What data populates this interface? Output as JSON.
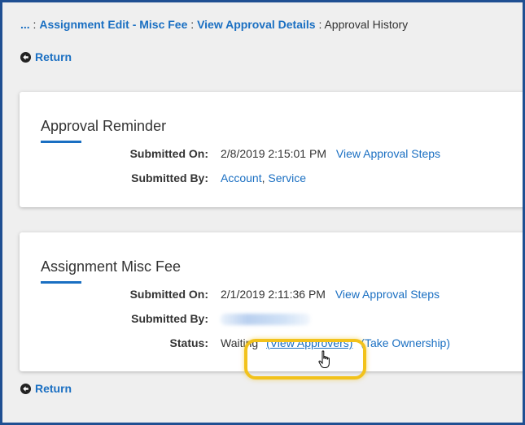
{
  "breadcrumb": {
    "ellipsis": "...",
    "sep1": " : ",
    "item1": "Assignment Edit - Misc Fee",
    "sep2": " : ",
    "item2": "View Approval Details",
    "sep3": " : ",
    "current": "Approval History"
  },
  "return_top": "Return",
  "return_bottom": "Return",
  "cards": [
    {
      "title": "Approval Reminder",
      "submitted_on_label": "Submitted On:",
      "submitted_on_value": "2/8/2019 2:15:01 PM",
      "view_steps": "View Approval Steps",
      "submitted_by_label": "Submitted By:",
      "submitted_by_last": "Account",
      "submitted_by_comma": ", ",
      "submitted_by_first": "Service"
    },
    {
      "title": "Assignment Misc Fee",
      "submitted_on_label": "Submitted On:",
      "submitted_on_value": "2/1/2019 2:11:36 PM",
      "view_steps": "View Approval Steps",
      "submitted_by_label": "Submitted By:",
      "status_label": "Status:",
      "status_value": "Waiting",
      "view_approvers": "(View Approvers)",
      "take_ownership": "(Take Ownership)"
    }
  ],
  "colors": {
    "link": "#1a6fc2",
    "highlight": "#f2c21b",
    "frame": "#1f4f92"
  }
}
